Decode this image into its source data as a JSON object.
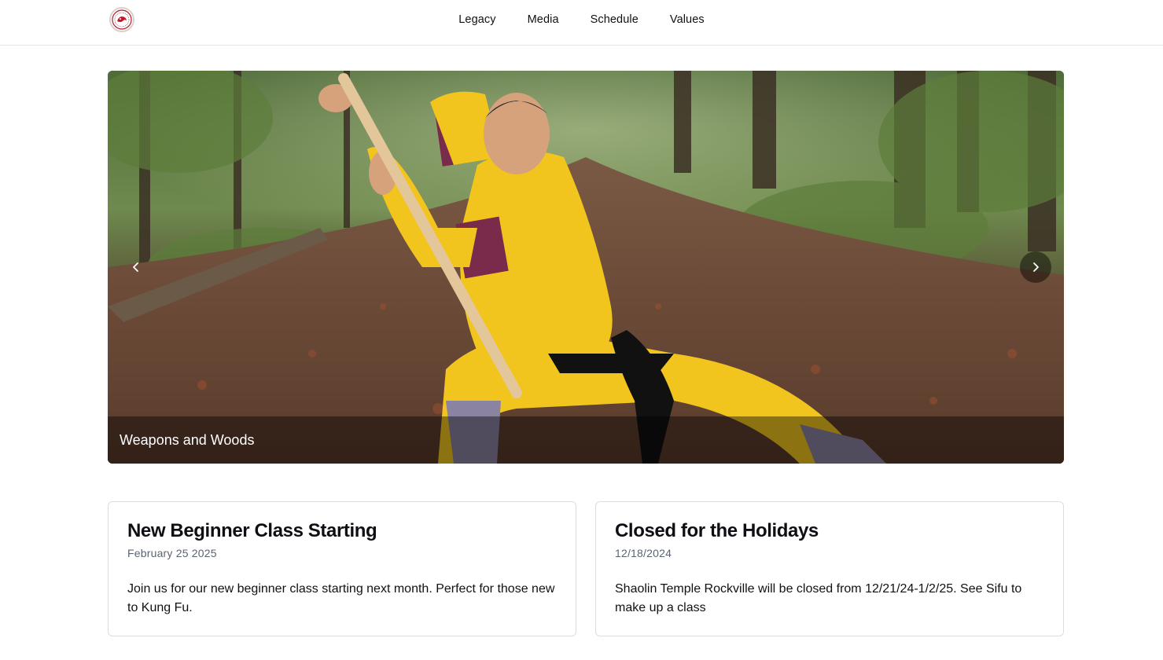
{
  "header": {
    "logo_name": "shaolin-temple-logo",
    "nav": [
      {
        "label": "Legacy"
      },
      {
        "label": "Media"
      },
      {
        "label": "Schedule"
      },
      {
        "label": "Values"
      }
    ]
  },
  "carousel": {
    "caption": "Weapons and Woods",
    "prev_icon": "chevron-left-icon",
    "next_icon": "chevron-right-icon"
  },
  "cards": [
    {
      "title": "New Beginner Class Starting",
      "date": "February 25 2025",
      "body": "Join us for our new beginner class starting next month. Perfect for those new to Kung Fu."
    },
    {
      "title": "Closed for the Holidays",
      "date": "12/18/2024",
      "body": "Shaolin Temple Rockville will be closed from 12/21/24-1/2/25. See Sifu to make up a class"
    }
  ],
  "colors": {
    "robe": "#f2c41e",
    "sleeve_trim": "#7a2a4a",
    "forest_green": "#3f5a2a",
    "leaf_floor": "#6b3f2e"
  }
}
